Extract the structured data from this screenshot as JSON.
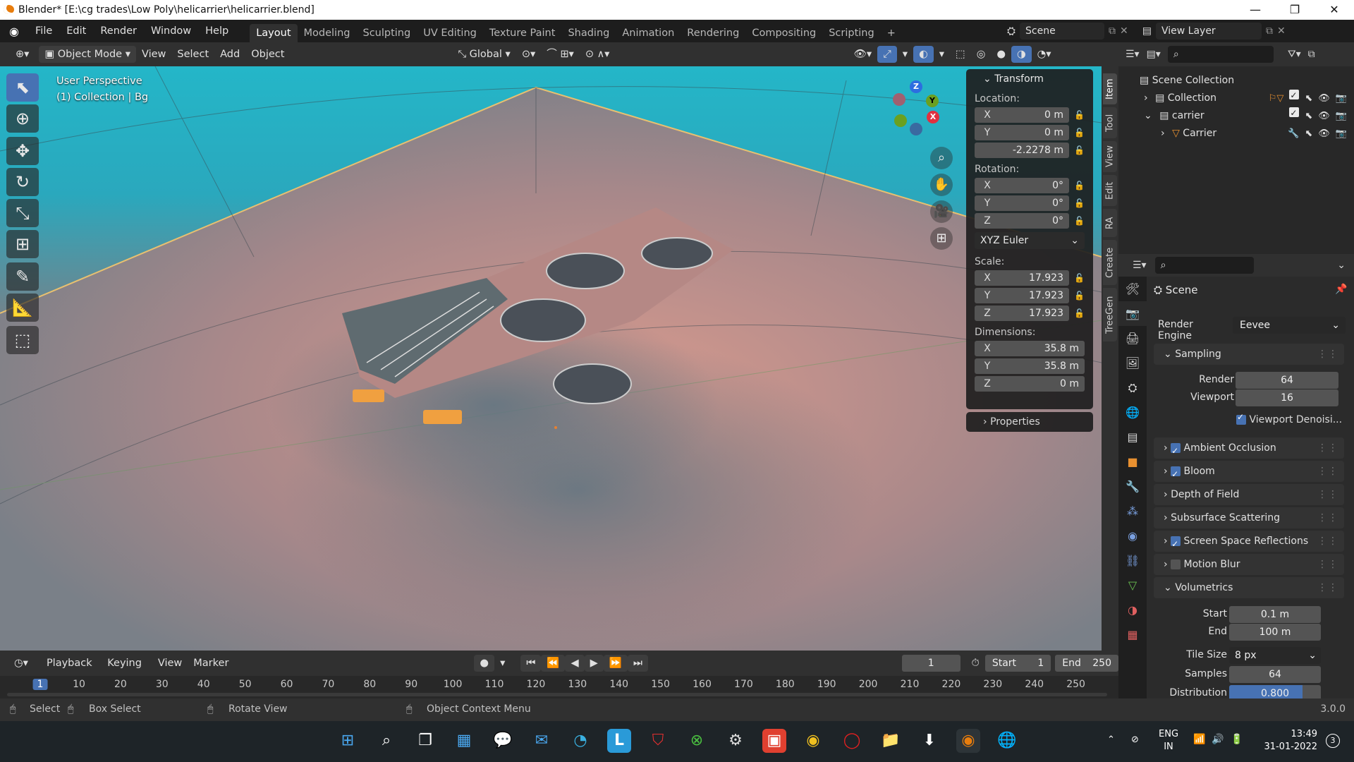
{
  "title": "Blender* [E:\\cg trades\\Low Poly\\helicarrier\\helicarrier.blend]",
  "window_controls": [
    "—",
    "❐",
    "✕"
  ],
  "menu": [
    "File",
    "Edit",
    "Render",
    "Window",
    "Help"
  ],
  "workspaces": [
    "Layout",
    "Modeling",
    "Sculpting",
    "UV Editing",
    "Texture Paint",
    "Shading",
    "Animation",
    "Rendering",
    "Compositing",
    "Scripting"
  ],
  "workspace_add": "+",
  "scene_name": "Scene",
  "view_layer": "View Layer",
  "viewport_header": {
    "mode": "Object Mode",
    "menus": [
      "View",
      "Select",
      "Add",
      "Object"
    ],
    "orientation": "Global"
  },
  "viewport": {
    "perspective": "User Perspective",
    "collection_info": "(1) Collection | Bg"
  },
  "gizmo": {
    "x": "X",
    "y": "Y",
    "z": "Z"
  },
  "transform": {
    "title": "Transform",
    "location_label": "Location:",
    "location": {
      "x": "0 m",
      "y": "0 m",
      "z": "-2.2278 m"
    },
    "rotation_label": "Rotation:",
    "rotation": {
      "x": "0°",
      "y": "0°",
      "z": "0°"
    },
    "rotation_mode": "XYZ Euler",
    "scale_label": "Scale:",
    "scale": {
      "x": "17.923",
      "y": "17.923",
      "z": "17.923"
    },
    "dimensions_label": "Dimensions:",
    "dimensions": {
      "x": "35.8 m",
      "y": "35.8 m",
      "z": "0 m"
    },
    "axis": {
      "x": "X",
      "y": "Y",
      "z": "Z"
    }
  },
  "properties_panel_label": "Properties",
  "sidebar_tabs": [
    "Item",
    "Tool",
    "View",
    "Edit",
    "RA",
    "Create",
    "TreeGen"
  ],
  "outliner": {
    "root": "Scene Collection",
    "items": [
      "Collection",
      "carrier",
      "Carrier"
    ]
  },
  "properties": {
    "context": "Scene",
    "render_engine_label": "Render Engine",
    "render_engine": "Eevee",
    "sampling": "Sampling",
    "render_label": "Render",
    "render_samples": "64",
    "viewport_label": "Viewport",
    "viewport_samples": "16",
    "viewport_denoise": "Viewport Denoisi...",
    "ambient_occlusion": "Ambient Occlusion",
    "bloom": "Bloom",
    "depth_of_field": "Depth of Field",
    "subsurface": "Subsurface Scattering",
    "ssr": "Screen Space Reflections",
    "motion_blur": "Motion Blur",
    "volumetrics": "Volumetrics",
    "start_label": "Start",
    "start": "0.1 m",
    "end_label": "End",
    "end": "100 m",
    "tile_size_label": "Tile Size",
    "tile_size": "8 px",
    "samples_label": "Samples",
    "samples": "64",
    "distribution_label": "Distribution",
    "distribution": "0.800",
    "distribution_fraction": 0.8
  },
  "timeline": {
    "menus": [
      "Playback",
      "Keying",
      "View",
      "Marker"
    ],
    "current_frame": "1",
    "start_label": "Start",
    "start": "1",
    "end_label": "End",
    "end": "250",
    "ruler": [
      "1",
      "10",
      "20",
      "30",
      "40",
      "50",
      "60",
      "70",
      "80",
      "90",
      "100",
      "110",
      "120",
      "130",
      "140",
      "150",
      "160",
      "170",
      "180",
      "190",
      "200",
      "210",
      "220",
      "230",
      "240",
      "250"
    ]
  },
  "status": {
    "select": "Select",
    "box_select": "Box Select",
    "rotate_view": "Rotate View",
    "context_menu": "Object Context Menu",
    "version": "3.0.0"
  },
  "taskbar": {
    "lang": "ENG",
    "region": "IN",
    "time": "13:49",
    "date": "31-01-2022",
    "notifications": "3"
  },
  "colors": {
    "accent": "#4772b3",
    "sky": "#24b6c8",
    "orange": "#e87d0d"
  }
}
